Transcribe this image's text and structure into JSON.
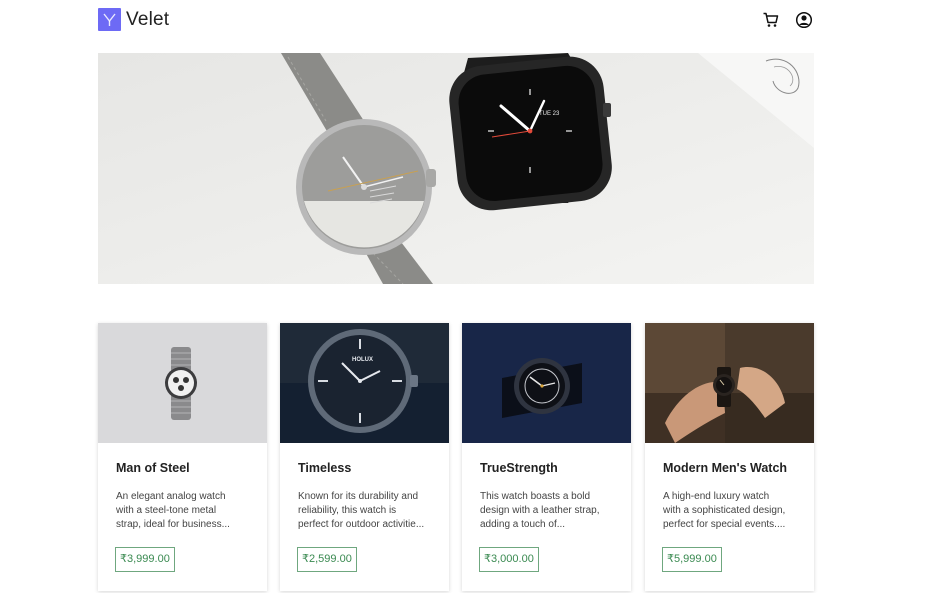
{
  "header": {
    "brand": "Velet",
    "logo_icon": "v-logo-icon",
    "cart_icon": "cart-icon",
    "user_icon": "user-account-icon",
    "logo_color": "#6d6af5"
  },
  "hero": {
    "image": "hero-watches-banner",
    "image_text": {
      "dial_date": "TUE 23"
    }
  },
  "products": [
    {
      "title": "Man of Steel",
      "desc_lines": [
        "An elegant analog watch",
        "with a steel-tone metal",
        "strap, ideal for business..."
      ],
      "price": "₹3,999.00"
    },
    {
      "title": "Timeless",
      "desc_lines": [
        "Known for its durability and",
        "reliability, this watch is",
        "perfect for outdoor activitie..."
      ],
      "price": "₹2,599.00",
      "image_text": "HOLUX"
    },
    {
      "title": "TrueStrength",
      "desc_lines": [
        "This watch boasts a bold",
        "design with a leather strap,",
        "adding a touch of..."
      ],
      "price": "₹3,000.00"
    },
    {
      "title": "Modern Men's Watch",
      "desc_lines": [
        "A high-end luxury watch",
        "with a sophisticated design,",
        "perfect for special events...."
      ],
      "price": "₹5,999.00"
    }
  ],
  "colors": {
    "price_border": "#6fa77f",
    "price_text": "#3a8a51"
  }
}
